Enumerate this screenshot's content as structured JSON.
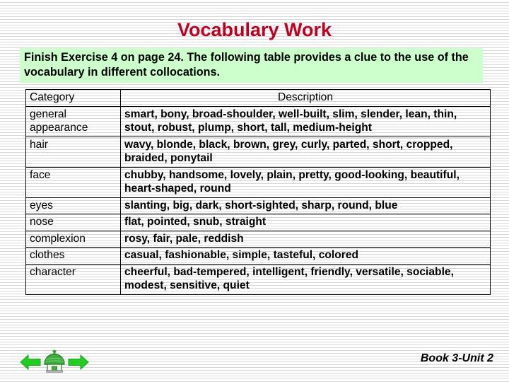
{
  "slide": {
    "title": "Vocabulary Work",
    "title_color": "#c00020",
    "intro": "Finish Exercise 4 on page 24. The following table provides a clue to the use of the vocabulary in different collocations.",
    "intro_highlight_color": "#ccffcc",
    "footer_label": "Book 3-Unit 2"
  },
  "table": {
    "headers": {
      "category": "Category",
      "description": "Description"
    },
    "rows": [
      {
        "category": "general appearance",
        "description": "smart, bony, broad-shoulder, well-built, slim, slender, lean, thin, stout, robust, plump, short, tall, medium-height"
      },
      {
        "category": "hair",
        "description": "wavy, blonde, black, brown, grey, curly, parted, short, cropped, braided, ponytail"
      },
      {
        "category": "face",
        "description": "chubby, handsome, lovely, plain, pretty, good-looking, beautiful, heart-shaped, round"
      },
      {
        "category": "eyes",
        "description": "slanting, big, dark, short-sighted, sharp, round, blue"
      },
      {
        "category": "nose",
        "description": "flat, pointed, snub, straight"
      },
      {
        "category": "complexion",
        "description": "rosy, fair, pale, reddish"
      },
      {
        "category": "clothes",
        "description": "casual, fashionable, simple, tasteful, colored"
      },
      {
        "category": "character",
        "description": "cheerful, bad-tempered, intelligent, friendly, versatile, sociable, modest, sensitive, quiet"
      }
    ]
  },
  "navigation": {
    "back_icon": "back-arrow-icon",
    "home_icon": "home-icon",
    "forward_icon": "forward-arrow-icon",
    "arrow_color": "#22cc22",
    "home_color": "#2f9e2f"
  }
}
